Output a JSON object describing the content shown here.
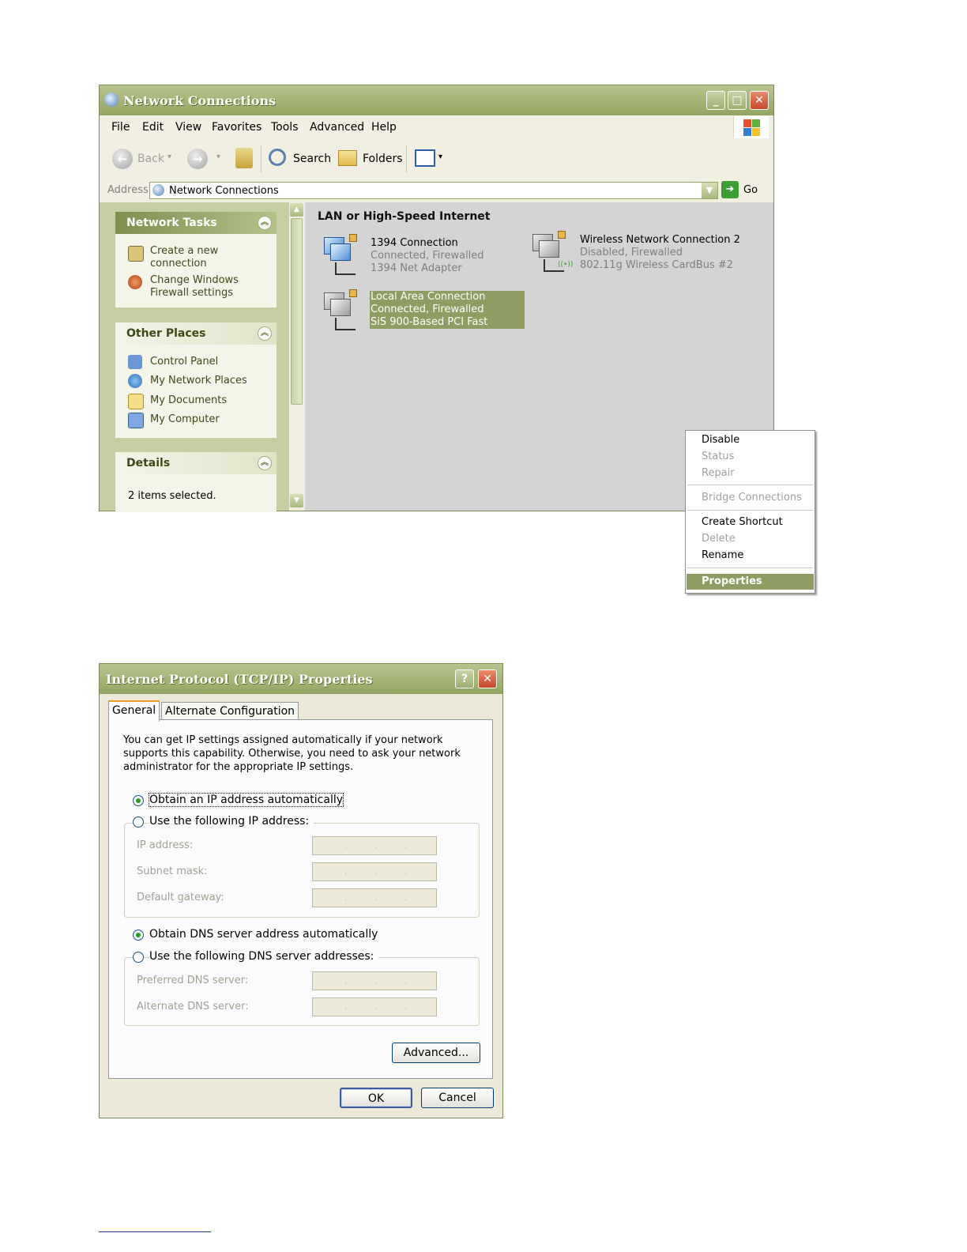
{
  "network_connections": {
    "title": "Network Connections",
    "menu": [
      "File",
      "Edit",
      "View",
      "Favorites",
      "Tools",
      "Advanced",
      "Help"
    ],
    "toolbar": {
      "back": "Back",
      "search": "Search",
      "folders": "Folders"
    },
    "address": {
      "label": "Address",
      "value": "Network Connections",
      "go": "Go"
    },
    "network_tasks": {
      "title": "Network Tasks",
      "items": [
        "Create a new",
        "connection",
        "Change Windows",
        "Firewall settings"
      ]
    },
    "other_places": {
      "title": "Other Places",
      "items": [
        "Control Panel",
        "My Network Places",
        "My Documents",
        "My Computer"
      ]
    },
    "details": {
      "title": "Details",
      "text": "2 items selected."
    },
    "group_title": "LAN or High-Speed Internet",
    "connections": [
      {
        "name": "1394 Connection",
        "status": "Connected, Firewalled",
        "device": "1394 Net Adapter"
      },
      {
        "name": "Wireless Network Connection 2",
        "status": "Disabled, Firewalled",
        "device": "802.11g Wireless CardBus #2"
      },
      {
        "name": "Local Area Connection",
        "status": "Connected, Firewalled",
        "device": "SiS 900-Based PCI Fast"
      }
    ],
    "context_menu": {
      "disable": "Disable",
      "status": "Status",
      "repair": "Repair",
      "bridge": "Bridge Connections",
      "shortcut": "Create Shortcut",
      "delete": "Delete",
      "rename": "Rename",
      "properties": "Properties"
    }
  },
  "tcpip": {
    "title": "Internet Protocol (TCP/IP) Properties",
    "tabs": [
      "General",
      "Alternate Configuration"
    ],
    "description": "You can get IP settings assigned automatically if your network supports this capability. Otherwise, you need to ask your network administrator for the appropriate IP settings.",
    "obtain_ip": "Obtain an IP address automatically",
    "use_ip": "Use the following IP address:",
    "ip_address": "IP address:",
    "subnet_mask": "Subnet mask:",
    "default_gateway": "Default gateway:",
    "obtain_dns": "Obtain DNS server address automatically",
    "use_dns": "Use the following DNS server addresses:",
    "preferred_dns": "Preferred DNS server:",
    "alternate_dns": "Alternate DNS server:",
    "advanced": "Advanced...",
    "ok": "OK",
    "cancel": "Cancel",
    "dot": "."
  }
}
